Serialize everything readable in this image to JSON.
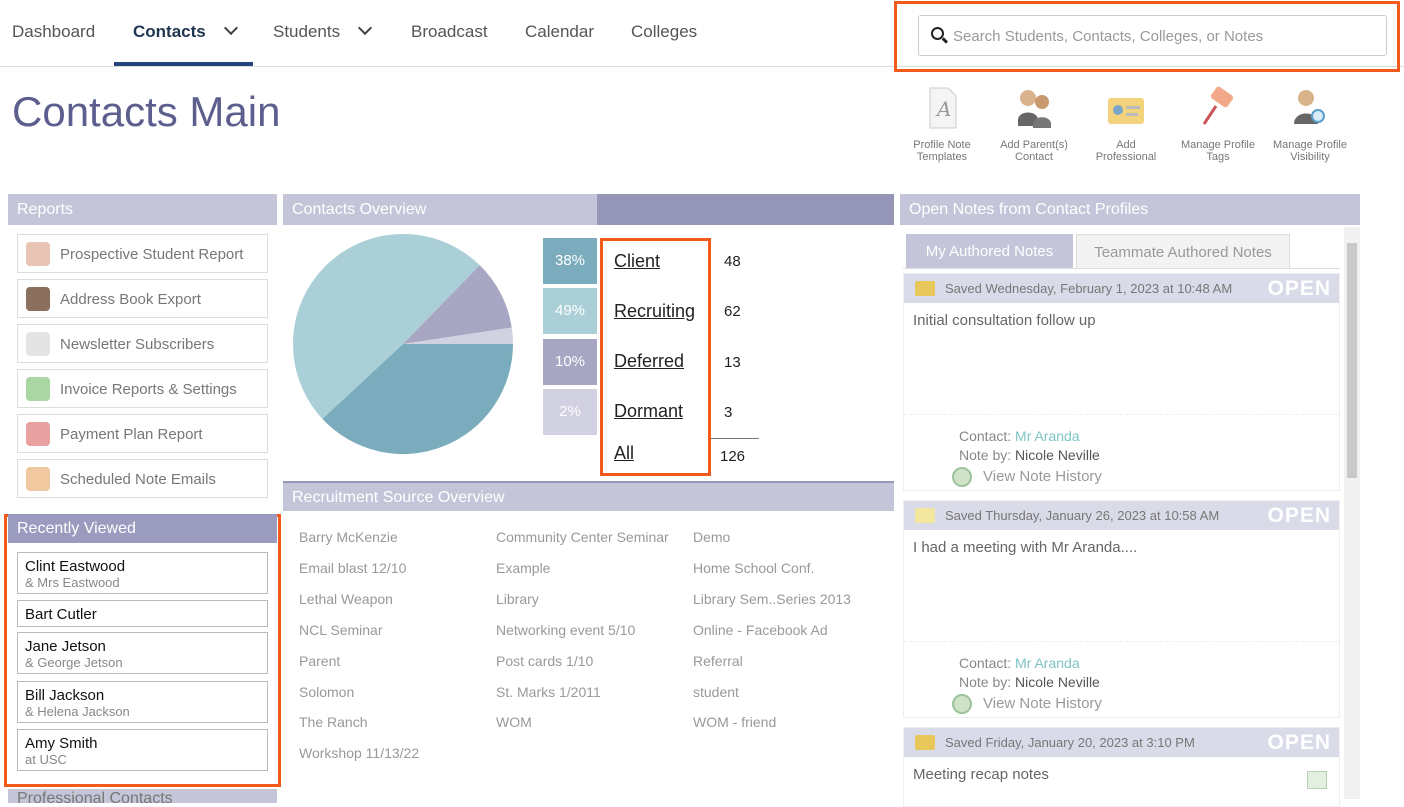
{
  "nav": {
    "items": [
      {
        "label": "Dashboard"
      },
      {
        "label": "Contacts"
      },
      {
        "label": "Students"
      },
      {
        "label": "Broadcast"
      },
      {
        "label": "Calendar"
      },
      {
        "label": "Colleges"
      }
    ],
    "active": "Contacts"
  },
  "search": {
    "placeholder": "Search Students, Contacts, Colleges, or Notes"
  },
  "page": {
    "title": "Contacts Main"
  },
  "toolbar": [
    {
      "label": "Profile Note Templates",
      "icon": "document-a-icon"
    },
    {
      "label": "Add Parent(s) Contact",
      "icon": "people-icon"
    },
    {
      "label": "Add Professional",
      "icon": "id-card-icon"
    },
    {
      "label": "Manage Profile Tags",
      "icon": "pin-icon"
    },
    {
      "label": "Manage Profile Visibility",
      "icon": "user-search-icon"
    }
  ],
  "reports": {
    "title": "Reports",
    "items": [
      {
        "label": "Prospective Student Report",
        "icon": "users-icon"
      },
      {
        "label": "Address Book Export",
        "icon": "book-export-icon"
      },
      {
        "label": "Newsletter Subscribers",
        "icon": "newspaper-icon"
      },
      {
        "label": "Invoice Reports & Settings",
        "icon": "invoice-dollar-icon"
      },
      {
        "label": "Payment Plan Report",
        "icon": "calendar-dollar-icon"
      },
      {
        "label": "Scheduled Note Emails",
        "icon": "clock-email-icon"
      }
    ]
  },
  "recent": {
    "title": "Recently Viewed",
    "items": [
      {
        "name": "Clint Eastwood",
        "sub": "& Mrs Eastwood"
      },
      {
        "name": "Bart Cutler",
        "sub": ""
      },
      {
        "name": "Jane Jetson",
        "sub": "& George Jetson"
      },
      {
        "name": "Bill Jackson",
        "sub": "& Helena Jackson"
      },
      {
        "name": "Amy Smith",
        "sub": "at USC"
      }
    ],
    "next_title": "Professional Contacts"
  },
  "overview": {
    "title": "Contacts Overview",
    "stats": [
      {
        "pct": "38%",
        "label": "Client",
        "count": "48",
        "color": "#7aacbd"
      },
      {
        "pct": "49%",
        "label": "Recruiting",
        "count": "62",
        "color": "#abcfd6"
      },
      {
        "pct": "10%",
        "label": "Deferred",
        "count": "13",
        "color": "#a7a6c3"
      },
      {
        "pct": "2%",
        "label": "Dormant",
        "count": "3",
        "color": "#d1d1e1"
      }
    ],
    "all_label": "All",
    "all_count": "126"
  },
  "chart_data": {
    "type": "pie",
    "categories": [
      "Client",
      "Recruiting",
      "Deferred",
      "Dormant"
    ],
    "values": [
      48,
      62,
      13,
      3
    ],
    "colors": [
      "#7aacbd",
      "#abcfd6",
      "#a7a6c3",
      "#d1d1e1"
    ]
  },
  "sources": {
    "title": "Recruitment Source Overview",
    "columns": [
      [
        "Barry McKenzie",
        "Email blast 12/10",
        "Lethal Weapon",
        "NCL Seminar",
        "Parent",
        "Solomon",
        "The Ranch",
        "Workshop 11/13/22"
      ],
      [
        "Community Center Seminar",
        "Example",
        "Library",
        "Networking event 5/10",
        "Post cards 1/10",
        "St. Marks 1/2011",
        "WOM"
      ],
      [
        "Demo",
        "Home School Conf.",
        "Library Sem..Series 2013",
        "Online - Facebook Ad",
        "Referral",
        "student",
        "WOM - friend"
      ]
    ]
  },
  "notes": {
    "title": "Open Notes from Contact Profiles",
    "tabs": [
      {
        "label": "My Authored Notes"
      },
      {
        "label": "Teammate Authored Notes"
      }
    ],
    "items": [
      {
        "saved": "Saved Wednesday, February 1, 2023 at 10:48 AM",
        "status": "OPEN",
        "body": "Initial consultation follow up",
        "contact_label": "Contact:",
        "contact": "Mr Aranda",
        "noteby_label": "Note by:",
        "noteby": "Nicole Neville",
        "history": "View Note History"
      },
      {
        "saved": "Saved Thursday, January 26, 2023 at 10:58 AM",
        "status": "OPEN",
        "body": "I had a meeting with Mr Aranda....",
        "contact_label": "Contact:",
        "contact": "Mr Aranda",
        "noteby_label": "Note by:",
        "noteby": "Nicole Neville",
        "history": "View Note History"
      },
      {
        "saved": "Saved Friday, January 20, 2023 at 3:10 PM",
        "status": "OPEN",
        "body": "Meeting recap notes"
      }
    ]
  }
}
